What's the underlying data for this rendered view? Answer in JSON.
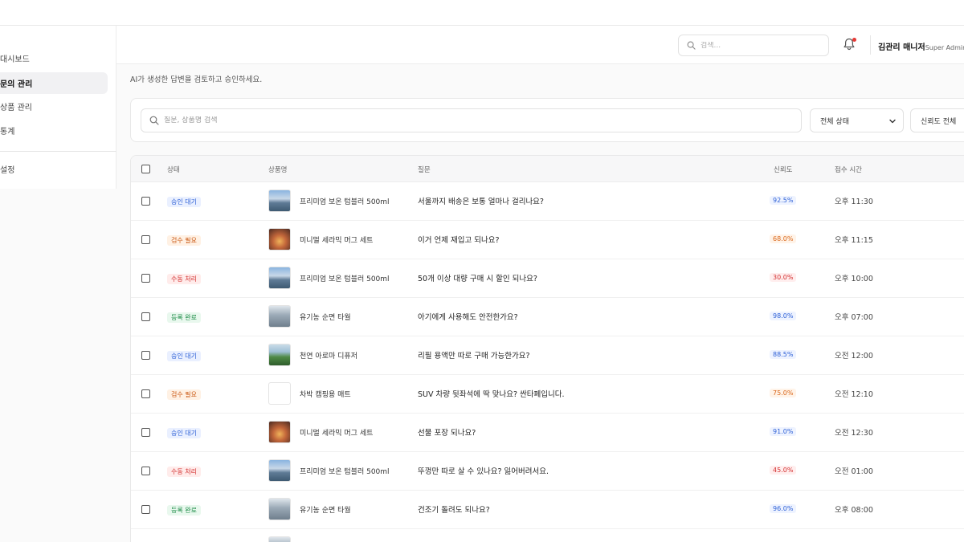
{
  "sidebar": {
    "items": [
      {
        "label": "대시보드",
        "active": false
      },
      {
        "label": "문의 관리",
        "active": true
      },
      {
        "label": "상품 관리",
        "active": false
      },
      {
        "label": "통계",
        "active": false
      }
    ],
    "settings_label": "설정"
  },
  "header": {
    "search_placeholder": "검색...",
    "user_name": "김관리 매니저",
    "user_role": "Super Admin",
    "has_notification": true
  },
  "page": {
    "subtitle": "AI가 생성한 답변을 검토하고 승인하세요."
  },
  "filters": {
    "search_placeholder": "질문, 상품명 검색",
    "status_select": "전체 상태",
    "confidence_select": "신뢰도 전체"
  },
  "table": {
    "columns": [
      "상태",
      "상품명",
      "질문",
      "신뢰도",
      "접수 시간"
    ],
    "rows": [
      {
        "status": "승인 대기",
        "status_type": "pending",
        "thumb": "mountain",
        "product": "프리미엄 보온 텀블러 500ml",
        "question": "서울까지 배송은 보통 얼마나 걸리나요?",
        "confidence": "92.5%",
        "conf_level": "high",
        "time": "오후 11:30"
      },
      {
        "status": "검수 필요",
        "status_type": "review",
        "thumb": "warm",
        "product": "미니멀 세라믹 머그 세트",
        "question": "이거 언제 재입고 되나요?",
        "confidence": "68.0%",
        "conf_level": "mid",
        "time": "오후 11:15"
      },
      {
        "status": "수동 처리",
        "status_type": "manual",
        "thumb": "mountain",
        "product": "프리미엄 보온 텀블러 500ml",
        "question": "50개 이상 대량 구매 시 할인 되나요?",
        "confidence": "30.0%",
        "conf_level": "low",
        "time": "오후 10:00"
      },
      {
        "status": "등록 완료",
        "status_type": "done",
        "thumb": "cloud",
        "product": "유기농 순면 타월",
        "question": "아기에게 사용해도 안전한가요?",
        "confidence": "98.0%",
        "conf_level": "high",
        "time": "오후 07:00"
      },
      {
        "status": "승인 대기",
        "status_type": "pending",
        "thumb": "green",
        "product": "천연 아로마 디퓨저",
        "question": "리필 용액만 따로 구매 가능한가요?",
        "confidence": "88.5%",
        "conf_level": "high",
        "time": "오전 12:00"
      },
      {
        "status": "검수 필요",
        "status_type": "review",
        "thumb": "empty",
        "product": "차박 캠핑용 매트",
        "question": "SUV 차량 뒷좌석에 딱 맞나요? 싼타페입니다.",
        "confidence": "75.0%",
        "conf_level": "mid",
        "time": "오전 12:10"
      },
      {
        "status": "승인 대기",
        "status_type": "pending",
        "thumb": "warm",
        "product": "미니멀 세라믹 머그 세트",
        "question": "선물 포장 되나요?",
        "confidence": "91.0%",
        "conf_level": "high",
        "time": "오전 12:30"
      },
      {
        "status": "수동 처리",
        "status_type": "manual",
        "thumb": "mountain",
        "product": "프리미엄 보온 텀블러 500ml",
        "question": "뚜껑만 따로 살 수 있나요? 잃어버려서요.",
        "confidence": "45.0%",
        "conf_level": "low",
        "time": "오전 01:00"
      },
      {
        "status": "등록 완료",
        "status_type": "done",
        "thumb": "cloud",
        "product": "유기농 순면 타월",
        "question": "건조기 돌려도 되나요?",
        "confidence": "96.0%",
        "conf_level": "high",
        "time": "오후 08:00"
      },
      {
        "status": "",
        "status_type": "pending",
        "thumb": "cloud",
        "product": "",
        "question": "",
        "confidence": "",
        "conf_level": "high",
        "time": ""
      }
    ]
  },
  "colors": {
    "accent_blue": "#2c5fd6",
    "warning_orange": "#d9661a",
    "danger_red": "#d32f2f",
    "success_green": "#1d8b47",
    "notification_dot": "#e53935"
  }
}
